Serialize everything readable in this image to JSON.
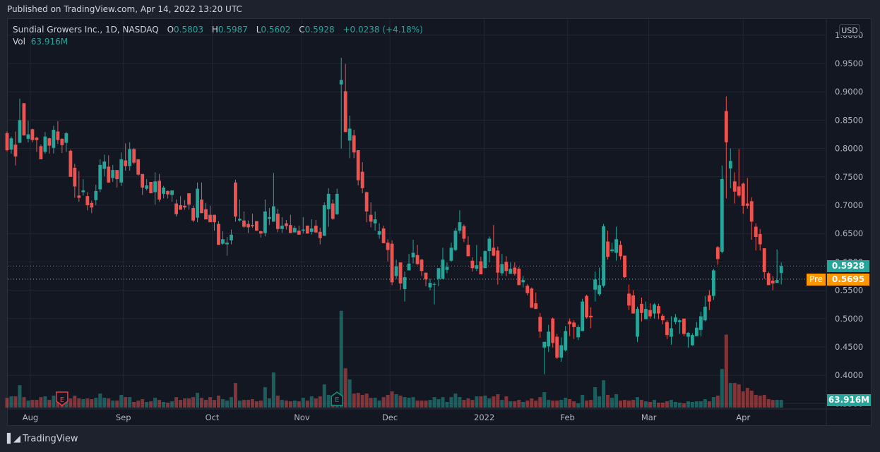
{
  "published": "Published on TradingView.com, Apr 14, 2022 13:20 UTC",
  "legend": {
    "name": "Sundial Growers Inc., 1D, NASDAQ",
    "open_label": "O",
    "open": "0.5803",
    "high_label": "H",
    "high": "0.5987",
    "low_label": "L",
    "low": "0.5602",
    "close_label": "C",
    "close": "0.5928",
    "change": "+0.0238 (+4.18%)",
    "vol_label": "Vol",
    "vol": "63.916M"
  },
  "currency": "USD",
  "last_price_tag": "0.5928",
  "premarket": {
    "label": "Pre",
    "price": "0.5695"
  },
  "volume_tag": "63.916M",
  "footer": {
    "logo": "TV",
    "brand": "TradingView"
  },
  "colors": {
    "up": "#26a69a",
    "down": "#ef5350",
    "pre": "#ff9800",
    "grid": "#232632"
  },
  "chart_data": {
    "type": "candlestick",
    "title": "Sundial Growers Inc., 1D, NASDAQ",
    "ylim": [
      0.35,
      1.0
    ],
    "y_ticks": [
      "1.0000",
      "0.9500",
      "0.9000",
      "0.8500",
      "0.8000",
      "0.7500",
      "0.7000",
      "0.6500",
      "0.6000",
      "0.5500",
      "0.5000",
      "0.4500",
      "0.4000",
      "0.3500"
    ],
    "x_ticks": [
      {
        "label": "Aug",
        "at_bar": 6.5
      },
      {
        "label": "Sep",
        "at_bar": 28.5
      },
      {
        "label": "Oct",
        "at_bar": 49.5
      },
      {
        "label": "Nov",
        "at_bar": 70.7
      },
      {
        "label": "Dec",
        "at_bar": 91.5
      },
      {
        "label": "2022",
        "at_bar": 113.8
      },
      {
        "label": "Feb",
        "at_bar": 133.5
      },
      {
        "label": "Mar",
        "at_bar": 152.7
      },
      {
        "label": "Apr",
        "at_bar": 175
      }
    ],
    "earnings": [
      {
        "bar": 14,
        "label": "E",
        "direction": "down"
      },
      {
        "bar": 79,
        "label": "E",
        "direction": "up"
      }
    ],
    "last_close": 0.5928,
    "premarket_price": 0.5695,
    "ohlc": [
      [
        0.827,
        0.83,
        0.795,
        0.797
      ],
      [
        0.798,
        0.821,
        0.791,
        0.818
      ],
      [
        0.807,
        0.83,
        0.77,
        0.786
      ],
      [
        0.81,
        0.888,
        0.81,
        0.85
      ],
      [
        0.88,
        0.88,
        0.823,
        0.823
      ],
      [
        0.817,
        0.849,
        0.811,
        0.825
      ],
      [
        0.834,
        0.835,
        0.811,
        0.815
      ],
      [
        0.819,
        0.821,
        0.794,
        0.815
      ],
      [
        0.804,
        0.807,
        0.781,
        0.781
      ],
      [
        0.794,
        0.829,
        0.791,
        0.821
      ],
      [
        0.818,
        0.819,
        0.791,
        0.805
      ],
      [
        0.801,
        0.84,
        0.791,
        0.833
      ],
      [
        0.83,
        0.848,
        0.808,
        0.815
      ],
      [
        0.817,
        0.818,
        0.792,
        0.806
      ],
      [
        0.81,
        0.829,
        0.794,
        0.827
      ],
      [
        0.796,
        0.798,
        0.75,
        0.75
      ],
      [
        0.766,
        0.773,
        0.713,
        0.733
      ],
      [
        0.717,
        0.76,
        0.706,
        0.713
      ],
      [
        0.723,
        0.746,
        0.717,
        0.726
      ],
      [
        0.716,
        0.723,
        0.691,
        0.7
      ],
      [
        0.704,
        0.708,
        0.686,
        0.696
      ],
      [
        0.709,
        0.736,
        0.7,
        0.725
      ],
      [
        0.728,
        0.781,
        0.723,
        0.771
      ],
      [
        0.764,
        0.789,
        0.751,
        0.777
      ],
      [
        0.768,
        0.788,
        0.74,
        0.74
      ],
      [
        0.748,
        0.771,
        0.741,
        0.762
      ],
      [
        0.762,
        0.762,
        0.731,
        0.746
      ],
      [
        0.74,
        0.793,
        0.734,
        0.781
      ],
      [
        0.779,
        0.809,
        0.761,
        0.769
      ],
      [
        0.769,
        0.811,
        0.761,
        0.799
      ],
      [
        0.799,
        0.801,
        0.772,
        0.775
      ],
      [
        0.781,
        0.781,
        0.752,
        0.754
      ],
      [
        0.755,
        0.755,
        0.718,
        0.731
      ],
      [
        0.729,
        0.746,
        0.726,
        0.735
      ],
      [
        0.741,
        0.741,
        0.721,
        0.721
      ],
      [
        0.723,
        0.758,
        0.701,
        0.742
      ],
      [
        0.743,
        0.755,
        0.706,
        0.71
      ],
      [
        0.72,
        0.734,
        0.712,
        0.731
      ],
      [
        0.725,
        0.726,
        0.712,
        0.719
      ],
      [
        0.718,
        0.726,
        0.706,
        0.726
      ],
      [
        0.703,
        0.71,
        0.68,
        0.684
      ],
      [
        0.7,
        0.716,
        0.692,
        0.692
      ],
      [
        0.699,
        0.709,
        0.692,
        0.696
      ],
      [
        0.721,
        0.721,
        0.692,
        0.701
      ],
      [
        0.695,
        0.699,
        0.67,
        0.673
      ],
      [
        0.678,
        0.74,
        0.67,
        0.729
      ],
      [
        0.71,
        0.74,
        0.686,
        0.686
      ],
      [
        0.693,
        0.704,
        0.675,
        0.675
      ],
      [
        0.683,
        0.699,
        0.67,
        0.67
      ],
      [
        0.683,
        0.683,
        0.655,
        0.67
      ],
      [
        0.667,
        0.672,
        0.63,
        0.63
      ],
      [
        0.632,
        0.654,
        0.63,
        0.64
      ],
      [
        0.631,
        0.644,
        0.611,
        0.634
      ],
      [
        0.638,
        0.657,
        0.631,
        0.648
      ],
      [
        0.74,
        0.745,
        0.671,
        0.68
      ],
      [
        0.673,
        0.71,
        0.671,
        0.676
      ],
      [
        0.673,
        0.689,
        0.66,
        0.662
      ],
      [
        0.667,
        0.673,
        0.651,
        0.661
      ],
      [
        0.665,
        0.685,
        0.66,
        0.663
      ],
      [
        0.672,
        0.672,
        0.655,
        0.655
      ],
      [
        0.654,
        0.655,
        0.643,
        0.65
      ],
      [
        0.651,
        0.71,
        0.645,
        0.689
      ],
      [
        0.676,
        0.695,
        0.665,
        0.679
      ],
      [
        0.671,
        0.757,
        0.671,
        0.698
      ],
      [
        0.685,
        0.694,
        0.652,
        0.658
      ],
      [
        0.658,
        0.679,
        0.651,
        0.664
      ],
      [
        0.668,
        0.674,
        0.657,
        0.663
      ],
      [
        0.665,
        0.683,
        0.651,
        0.651
      ],
      [
        0.652,
        0.664,
        0.652,
        0.66
      ],
      [
        0.655,
        0.664,
        0.648,
        0.648
      ],
      [
        0.655,
        0.679,
        0.65,
        0.657
      ],
      [
        0.664,
        0.664,
        0.65,
        0.65
      ],
      [
        0.653,
        0.675,
        0.648,
        0.659
      ],
      [
        0.664,
        0.674,
        0.651,
        0.652
      ],
      [
        0.653,
        0.66,
        0.631,
        0.642
      ],
      [
        0.646,
        0.705,
        0.646,
        0.7
      ],
      [
        0.693,
        0.73,
        0.662,
        0.72
      ],
      [
        0.703,
        0.71,
        0.674,
        0.676
      ],
      [
        0.684,
        0.729,
        0.683,
        0.72
      ],
      [
        0.913,
        0.96,
        0.8,
        0.921
      ],
      [
        0.901,
        0.949,
        0.829,
        0.829
      ],
      [
        0.814,
        0.858,
        0.783,
        0.835
      ],
      [
        0.823,
        0.833,
        0.783,
        0.793
      ],
      [
        0.797,
        0.797,
        0.735,
        0.744
      ],
      [
        0.759,
        0.776,
        0.721,
        0.73
      ],
      [
        0.723,
        0.724,
        0.67,
        0.689
      ],
      [
        0.683,
        0.705,
        0.661,
        0.671
      ],
      [
        0.668,
        0.689,
        0.655,
        0.675
      ],
      [
        0.648,
        0.668,
        0.641,
        0.654
      ],
      [
        0.659,
        0.664,
        0.633,
        0.633
      ],
      [
        0.634,
        0.64,
        0.601,
        0.621
      ],
      [
        0.632,
        0.638,
        0.559,
        0.564
      ],
      [
        0.575,
        0.604,
        0.57,
        0.592
      ],
      [
        0.599,
        0.599,
        0.551,
        0.562
      ],
      [
        0.552,
        0.583,
        0.53,
        0.573
      ],
      [
        0.585,
        0.614,
        0.585,
        0.597
      ],
      [
        0.608,
        0.639,
        0.597,
        0.616
      ],
      [
        0.612,
        0.63,
        0.595,
        0.596
      ],
      [
        0.604,
        0.605,
        0.575,
        0.584
      ],
      [
        0.581,
        0.581,
        0.557,
        0.569
      ],
      [
        0.555,
        0.57,
        0.55,
        0.563
      ],
      [
        0.56,
        0.564,
        0.525,
        0.561
      ],
      [
        0.57,
        0.589,
        0.557,
        0.589
      ],
      [
        0.57,
        0.625,
        0.57,
        0.604
      ],
      [
        0.586,
        0.599,
        0.58,
        0.591
      ],
      [
        0.602,
        0.634,
        0.6,
        0.625
      ],
      [
        0.621,
        0.66,
        0.619,
        0.655
      ],
      [
        0.655,
        0.691,
        0.65,
        0.67
      ],
      [
        0.663,
        0.666,
        0.635,
        0.641
      ],
      [
        0.63,
        0.645,
        0.61,
        0.61
      ],
      [
        0.602,
        0.608,
        0.583,
        0.589
      ],
      [
        0.588,
        0.63,
        0.584,
        0.594
      ],
      [
        0.601,
        0.609,
        0.578,
        0.578
      ],
      [
        0.589,
        0.62,
        0.589,
        0.619
      ],
      [
        0.619,
        0.645,
        0.599,
        0.641
      ],
      [
        0.625,
        0.665,
        0.61,
        0.611
      ],
      [
        0.62,
        0.627,
        0.56,
        0.581
      ],
      [
        0.58,
        0.614,
        0.576,
        0.596
      ],
      [
        0.6,
        0.61,
        0.575,
        0.584
      ],
      [
        0.579,
        0.599,
        0.579,
        0.588
      ],
      [
        0.59,
        0.599,
        0.576,
        0.579
      ],
      [
        0.588,
        0.591,
        0.559,
        0.559
      ],
      [
        0.564,
        0.575,
        0.555,
        0.568
      ],
      [
        0.558,
        0.561,
        0.541,
        0.545
      ],
      [
        0.553,
        0.555,
        0.519,
        0.519
      ],
      [
        0.527,
        0.546,
        0.517,
        0.517
      ],
      [
        0.503,
        0.51,
        0.466,
        0.477
      ],
      [
        0.449,
        0.459,
        0.402,
        0.459
      ],
      [
        0.451,
        0.489,
        0.441,
        0.477
      ],
      [
        0.5,
        0.502,
        0.449,
        0.457
      ],
      [
        0.468,
        0.473,
        0.429,
        0.431
      ],
      [
        0.431,
        0.467,
        0.424,
        0.453
      ],
      [
        0.444,
        0.487,
        0.442,
        0.478
      ],
      [
        0.495,
        0.5,
        0.469,
        0.49
      ],
      [
        0.493,
        0.497,
        0.464,
        0.485
      ],
      [
        0.467,
        0.489,
        0.462,
        0.485
      ],
      [
        0.478,
        0.535,
        0.478,
        0.53
      ],
      [
        0.54,
        0.542,
        0.5,
        0.502
      ],
      [
        0.505,
        0.52,
        0.483,
        0.502
      ],
      [
        0.551,
        0.583,
        0.53,
        0.569
      ],
      [
        0.543,
        0.59,
        0.54,
        0.559
      ],
      [
        0.558,
        0.667,
        0.555,
        0.663
      ],
      [
        0.636,
        0.655,
        0.604,
        0.609
      ],
      [
        0.619,
        0.634,
        0.616,
        0.622
      ],
      [
        0.616,
        0.662,
        0.602,
        0.64
      ],
      [
        0.63,
        0.637,
        0.604,
        0.61
      ],
      [
        0.611,
        0.611,
        0.572,
        0.573
      ],
      [
        0.544,
        0.56,
        0.515,
        0.523
      ],
      [
        0.541,
        0.55,
        0.509,
        0.509
      ],
      [
        0.468,
        0.521,
        0.459,
        0.517
      ],
      [
        0.526,
        0.537,
        0.495,
        0.51
      ],
      [
        0.499,
        0.53,
        0.499,
        0.517
      ],
      [
        0.515,
        0.527,
        0.5,
        0.504
      ],
      [
        0.509,
        0.527,
        0.5,
        0.525
      ],
      [
        0.522,
        0.526,
        0.499,
        0.509
      ],
      [
        0.505,
        0.508,
        0.49,
        0.497
      ],
      [
        0.494,
        0.497,
        0.464,
        0.471
      ],
      [
        0.468,
        0.504,
        0.454,
        0.483
      ],
      [
        0.494,
        0.508,
        0.49,
        0.502
      ],
      [
        0.494,
        0.499,
        0.473,
        0.497
      ],
      [
        0.5,
        0.5,
        0.469,
        0.473
      ],
      [
        0.468,
        0.476,
        0.449,
        0.475
      ],
      [
        0.453,
        0.474,
        0.452,
        0.471
      ],
      [
        0.469,
        0.494,
        0.469,
        0.484
      ],
      [
        0.48,
        0.512,
        0.469,
        0.504
      ],
      [
        0.497,
        0.54,
        0.495,
        0.521
      ],
      [
        0.541,
        0.55,
        0.515,
        0.53
      ],
      [
        0.54,
        0.588,
        0.533,
        0.585
      ],
      [
        0.626,
        0.628,
        0.595,
        0.605
      ],
      [
        0.618,
        0.77,
        0.615,
        0.746
      ],
      [
        0.866,
        0.892,
        0.712,
        0.811
      ],
      [
        0.765,
        0.8,
        0.73,
        0.778
      ],
      [
        0.742,
        0.758,
        0.703,
        0.724
      ],
      [
        0.733,
        0.799,
        0.714,
        0.717
      ],
      [
        0.738,
        0.74,
        0.685,
        0.699
      ],
      [
        0.703,
        0.748,
        0.694,
        0.699
      ],
      [
        0.707,
        0.714,
        0.639,
        0.671
      ],
      [
        0.662,
        0.668,
        0.62,
        0.644
      ],
      [
        0.649,
        0.658,
        0.62,
        0.631
      ],
      [
        0.624,
        0.624,
        0.57,
        0.582
      ],
      [
        0.58,
        0.583,
        0.559,
        0.559
      ],
      [
        0.567,
        0.575,
        0.55,
        0.562
      ],
      [
        0.563,
        0.622,
        0.563,
        0.568
      ],
      [
        0.5803,
        0.5987,
        0.5602,
        0.5928
      ]
    ],
    "volume_millions": [
      80,
      93,
      93,
      186,
      87,
      58,
      64,
      64,
      87,
      93,
      64,
      99,
      70,
      76,
      60,
      76,
      99,
      76,
      70,
      76,
      70,
      81,
      116,
      81,
      76,
      58,
      58,
      105,
      87,
      87,
      47,
      58,
      70,
      47,
      52,
      81,
      64,
      47,
      41,
      52,
      87,
      64,
      76,
      76,
      87,
      122,
      81,
      64,
      87,
      64,
      99,
      70,
      58,
      87,
      204,
      58,
      64,
      64,
      70,
      52,
      58,
      169,
      76,
      291,
      99,
      64,
      58,
      52,
      58,
      52,
      81,
      58,
      93,
      76,
      93,
      192,
      105,
      90,
      100,
      803,
      326,
      233,
      116,
      122,
      105,
      116,
      81,
      81,
      58,
      87,
      105,
      134,
      111,
      99,
      87,
      81,
      87,
      58,
      58,
      58,
      64,
      87,
      70,
      87,
      47,
      87,
      116,
      87,
      64,
      76,
      64,
      93,
      93,
      99,
      76,
      93,
      111,
      64,
      93,
      52,
      52,
      64,
      47,
      58,
      76,
      58,
      87,
      128,
      64,
      58,
      58,
      64,
      81,
      70,
      52,
      35,
      105,
      58,
      64,
      169,
      93,
      227,
      105,
      81,
      111,
      58,
      64,
      58,
      64,
      87,
      64,
      52,
      47,
      64,
      41,
      41,
      52,
      64,
      47,
      41,
      35,
      52,
      47,
      52,
      52,
      70,
      52,
      87,
      99,
      320,
      605,
      204,
      204,
      192,
      134,
      163,
      140,
      105,
      99,
      105,
      70,
      64,
      64,
      63.916
    ]
  }
}
